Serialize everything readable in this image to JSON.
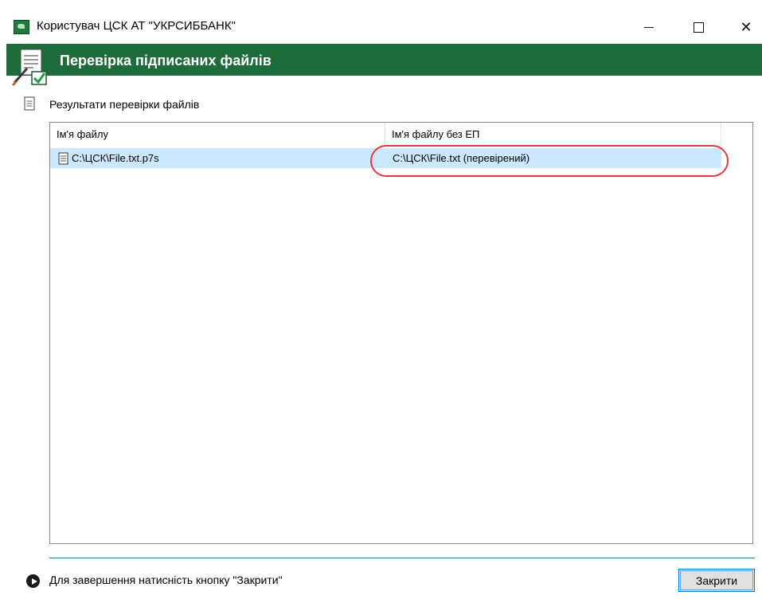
{
  "window": {
    "title": "Користувач ЦСК АТ \"УКРСИББАНК\"",
    "minimize_symbol": "",
    "close_symbol": "✕"
  },
  "header": {
    "title": "Перевірка підписаних файлів"
  },
  "section": {
    "label": "Результати перевірки файлів"
  },
  "table": {
    "columns": [
      "Ім'я файлу",
      "Ім'я файлу без ЕП"
    ],
    "rows": [
      {
        "file_name": "C:\\ЦСК\\File.txt.p7s",
        "file_name_without_signature": "C:\\ЦСК\\File.txt (перевірений)"
      }
    ]
  },
  "footer": {
    "hint": "Для завершення натисність кнопку \"Закрити\"",
    "close_label": "Закрити"
  },
  "colors": {
    "header_green": "#1e6b3b",
    "selection": "#cce8ff",
    "highlight_red": "#e8353f",
    "separator": "#2d7b75"
  }
}
